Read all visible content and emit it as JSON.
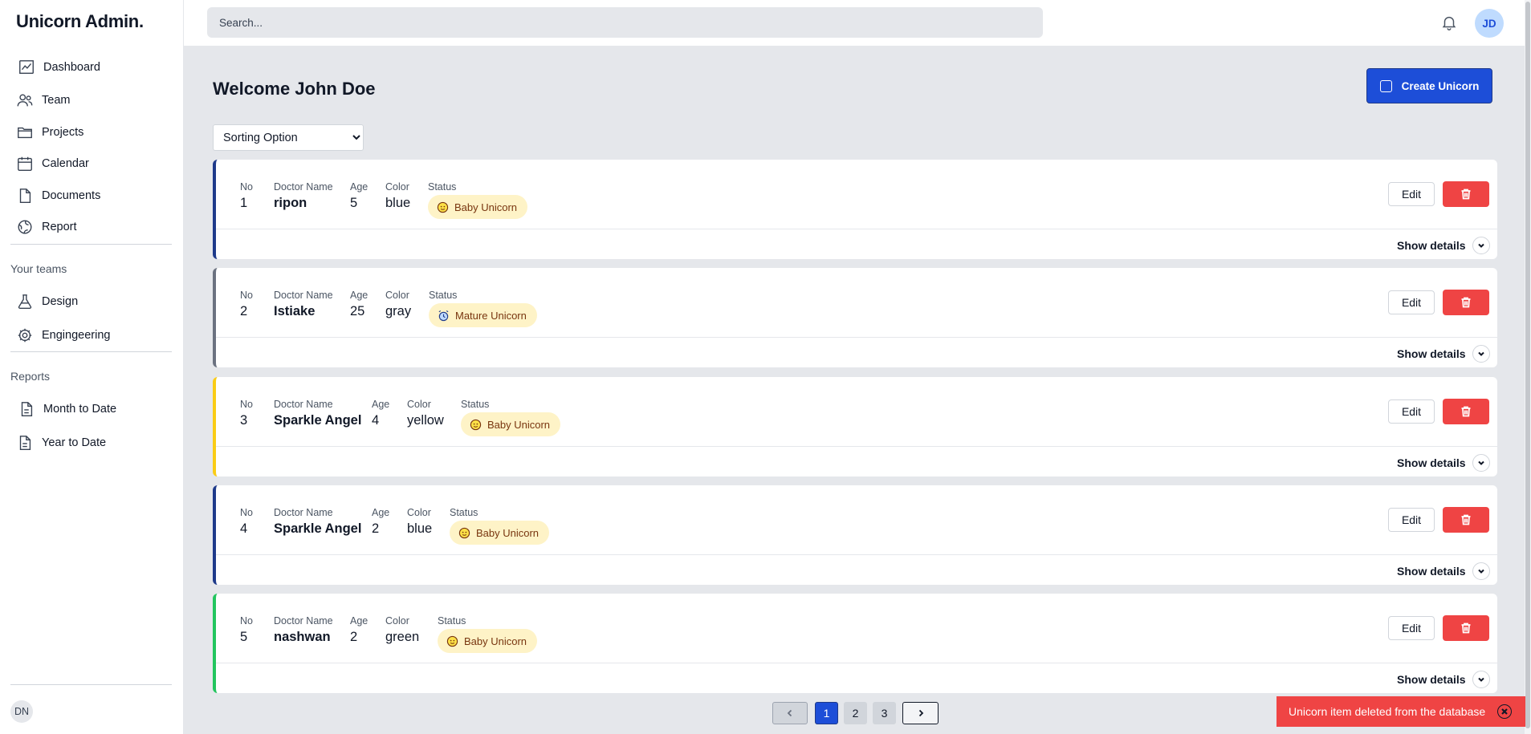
{
  "app": {
    "logo": "Unicorn Admin."
  },
  "sidebar": {
    "nav": [
      {
        "label": "Dashboard",
        "icon": "chart-icon"
      },
      {
        "label": "Team",
        "icon": "users-icon"
      },
      {
        "label": "Projects",
        "icon": "folder-icon"
      },
      {
        "label": "Calendar",
        "icon": "calendar-icon"
      },
      {
        "label": "Documents",
        "icon": "document-icon"
      },
      {
        "label": "Report",
        "icon": "globe-icon"
      }
    ],
    "teams_label": "Your teams",
    "teams": [
      {
        "label": "Design",
        "icon": "flask-icon"
      },
      {
        "label": "Engingeering",
        "icon": "cog-icon"
      }
    ],
    "reports_label": "Reports",
    "reports": [
      {
        "label": "Month to Date",
        "icon": "document-icon"
      },
      {
        "label": "Year to Date",
        "icon": "document-icon"
      }
    ],
    "user_initials": "DN"
  },
  "header": {
    "search_placeholder": "Search...",
    "avatar_initials": "JD"
  },
  "main": {
    "welcome": "Welcome John Doe",
    "create_label": "Create Unicorn",
    "sort_selected": "Sorting Option",
    "labels": {
      "no": "No",
      "name": "Doctor Name",
      "age": "Age",
      "color": "Color",
      "status": "Status"
    },
    "edit_label": "Edit",
    "details_label": "Show details",
    "items": [
      {
        "no": "1",
        "name": "ripon",
        "age": "5",
        "color": "blue",
        "status": "Baby Unicorn",
        "accent": "#1e3a8a"
      },
      {
        "no": "2",
        "name": "Istiake",
        "age": "25",
        "color": "gray",
        "status": "Mature Unicorn",
        "accent": "#6b7280"
      },
      {
        "no": "3",
        "name": "Sparkle Angel",
        "age": "4",
        "color": "yellow",
        "status": "Baby Unicorn",
        "accent": "#facc15"
      },
      {
        "no": "4",
        "name": "Sparkle Angel",
        "age": "2",
        "color": "blue",
        "status": "Baby Unicorn",
        "accent": "#1e3a8a"
      },
      {
        "no": "5",
        "name": "nashwan",
        "age": "2",
        "color": "green",
        "status": "Baby Unicorn",
        "accent": "#22c55e"
      }
    ]
  },
  "pagination": {
    "pages": [
      "1",
      "2",
      "3"
    ],
    "active": "1"
  },
  "toast": {
    "message": "Unicorn item deleted from the database"
  }
}
